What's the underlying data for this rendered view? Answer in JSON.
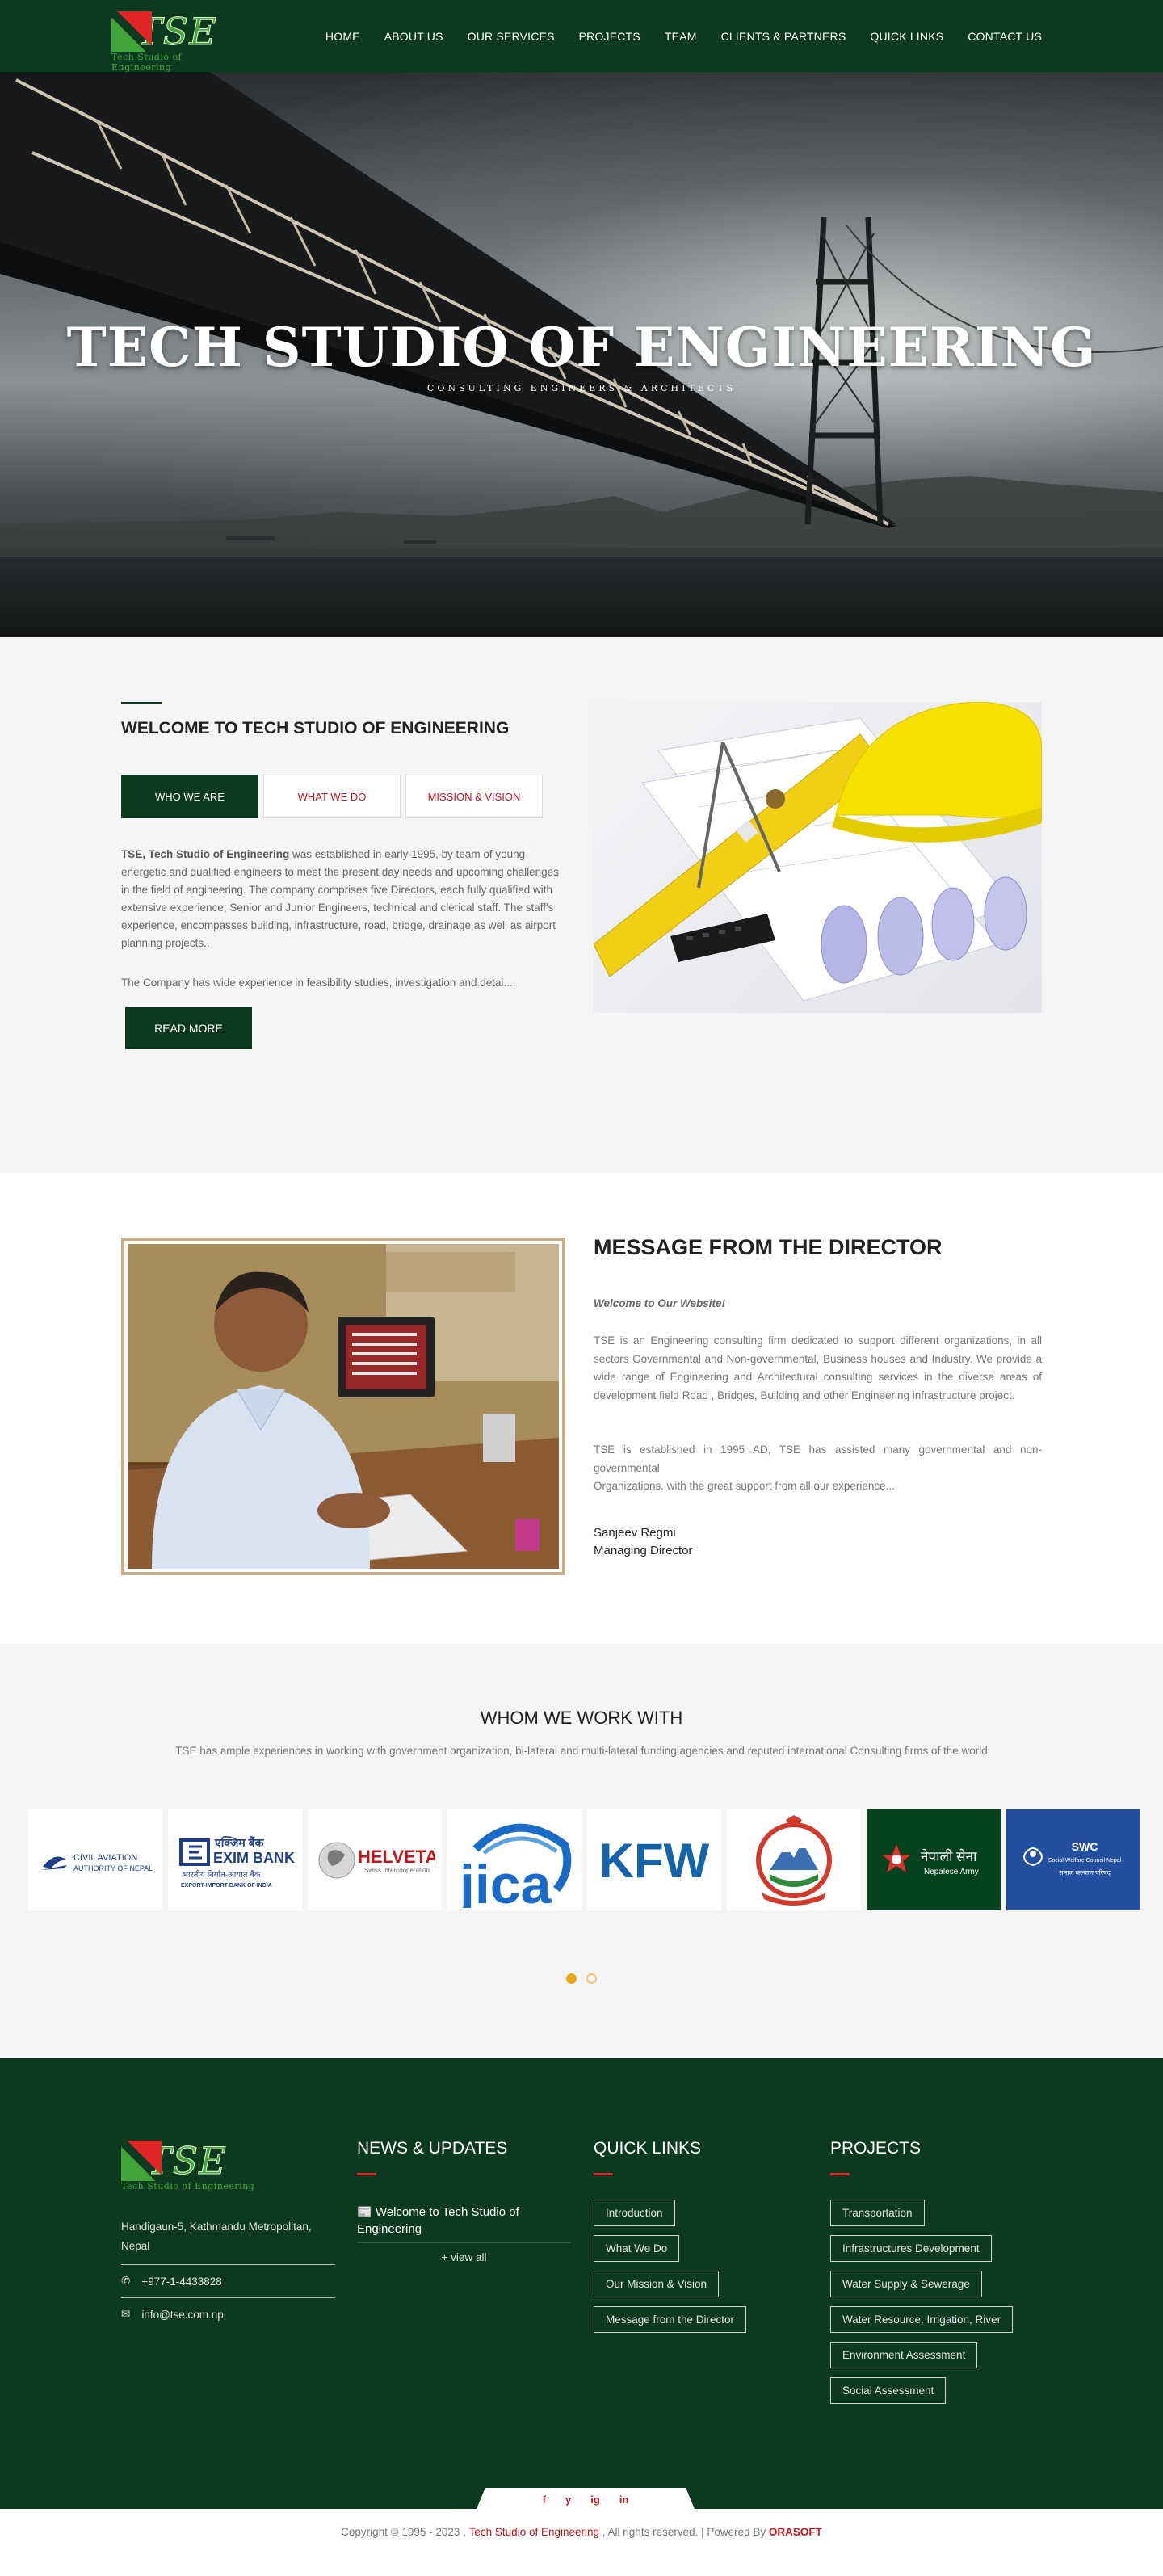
{
  "brand": {
    "logo_letters": "TSE",
    "logo_sub": "Tech Studio of Engineering"
  },
  "nav": {
    "items": [
      "HOME",
      "ABOUT US",
      "OUR SERVICES",
      "PROJECTS",
      "TEAM",
      "CLIENTS & PARTNERS",
      "QUICK LINKS",
      "CONTACT US"
    ]
  },
  "hero": {
    "title": "TECH STUDIO OF ENGINEERING",
    "subtitle": "CONSULTING ENGINEERS & ARCHITECTS"
  },
  "welcome": {
    "heading": "WELCOME TO TECH STUDIO OF ENGINEERING",
    "tabs": [
      "WHO WE ARE",
      "WHAT WE DO",
      "MISSION & VISION"
    ],
    "active_tab": 0,
    "intro_bold": "TSE, Tech Studio of Engineering",
    "intro_rest": " was established in  early 1995, by team of young energetic and qualified engineers to meet the present day needs and upcoming challenges in the field of engineering. The company comprises five Directors, each fully qualified with extensive experience, Senior and Junior Engineers, technical and clerical staff. The staff's experience, encompasses building, infrastructure, road, bridge, drainage as well as airport planning projects..",
    "para2": "The Company has wide experience in feasibility studies, investigation and detai....",
    "read_more": "READ MORE"
  },
  "director": {
    "heading": "MESSAGE FROM THE DIRECTOR",
    "welcome": "Welcome to Our Website!",
    "para1": "TSE is an Engineering consulting firm dedicated to support different organizations, in all sectors Governmental and Non-governmental, Business houses and Industry. We provide a wide range of Engineering and Architectural consulting services in the diverse areas of development field Road , Bridges, Building and other Engineering infrastructure project.",
    "para2": "TSE is established in 1995 AD, TSE has assisted many governmental and non-governmental",
    "para3": " Organizations. with the great support from all our experience...",
    "name": "Sanjeev Regmi",
    "role": "Managing Director"
  },
  "partners": {
    "heading": "WHOM WE WORK WITH",
    "description": "TSE has ample experiences in working with government organization, bi-lateral and multi-lateral funding agencies and reputed international Consulting firms of the world",
    "logos": {
      "caan_line1": "CIVIL AVIATION",
      "caan_line2": "AUTHORITY OF NEPAL",
      "exim_nepali": "एक्जिम बैंक",
      "exim_name": "EXIM BANK",
      "exim_sub1": "भारतीय निर्यात-आयात बैंक",
      "exim_sub2": "EXPORT-IMPORT BANK OF INDIA",
      "helvetas_name": "HELVETAS",
      "helvetas_sub": "Swiss Intercooperation",
      "jica": "jica",
      "kfw": "KFW",
      "army_nepali": "नेपाली सेना",
      "army_en": "Nepalese Army",
      "swc_name": "SWC",
      "swc_sub": "Social Welfare Council Nepal",
      "swc_nepali": "समाज कल्याण परिषद्"
    },
    "dots": 2,
    "active_dot": 0
  },
  "footer": {
    "address": "Handigaun-5, Kathmandu Metropolitan, Nepal",
    "phone": "+977-1-4433828",
    "email": "info@tse.com.np",
    "news_heading": "NEWS & UPDATES",
    "news_item": "Welcome to Tech Studio of Engineering",
    "view_all": "+ view all",
    "quick_heading": "QUICK LINKS",
    "quick_links": [
      "Introduction",
      "What We Do",
      "Our Mission & Vision",
      "Message from the Director"
    ],
    "projects_heading": "PROJECTS",
    "projects": [
      "Transportation",
      "Infrastructures Development",
      "Water Supply & Sewerage",
      "Water Resource, Irrigation, River",
      "Environment Assessment",
      "Social Assessment"
    ],
    "social": [
      "f",
      "y",
      "ig",
      "in"
    ]
  },
  "copyright": {
    "prefix": "Copyright © 1995 - 2023 ,",
    "company": "Tech Studio of Engineering",
    "middle": ", All rights reserved. | Powered By",
    "powered": "ORASOFT"
  },
  "colors": {
    "primary_green": "#0c3a1f",
    "accent_red": "#c0151b",
    "logo_green": "#43a63b",
    "dot_gold": "#e8a81e"
  }
}
